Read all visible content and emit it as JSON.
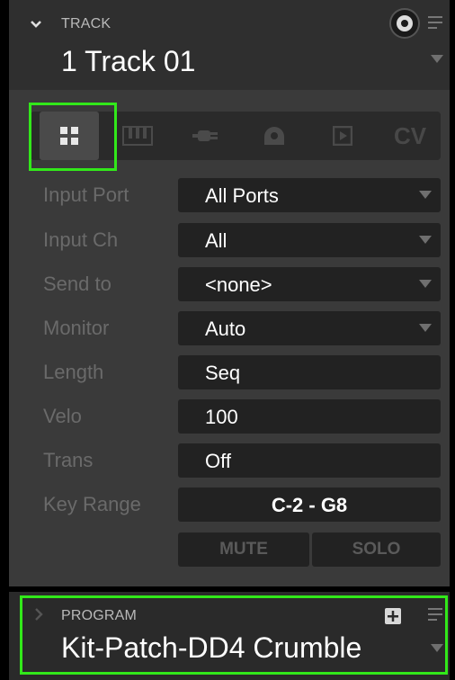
{
  "track": {
    "section_label": "TRACK",
    "name": "1 Track 01"
  },
  "tabs": [
    {
      "icon": "grid-icon",
      "active": true
    },
    {
      "icon": "piano-keys-icon",
      "active": false
    },
    {
      "icon": "plug-icon",
      "active": false
    },
    {
      "icon": "midi-port-icon",
      "active": false
    },
    {
      "icon": "play-box-icon",
      "active": false
    },
    {
      "label": "CV",
      "active": false
    }
  ],
  "rows": [
    {
      "label": "Input Port",
      "value": "All Ports"
    },
    {
      "label": "Input Ch",
      "value": "All"
    },
    {
      "label": "Send to",
      "value": "<none>"
    },
    {
      "label": "Monitor",
      "value": "Auto"
    },
    {
      "label": "Length",
      "value": "Seq"
    },
    {
      "label": "Velo",
      "value": "100"
    },
    {
      "label": "Trans",
      "value": "Off"
    },
    {
      "label": "Key Range",
      "value": "C-2 - G8"
    }
  ],
  "buttons": {
    "mute": "MUTE",
    "solo": "SOLO"
  },
  "program": {
    "section_label": "PROGRAM",
    "name": "Kit-Patch-DD4 Crumble"
  },
  "colors": {
    "highlight": "#32e81a",
    "panel": "#3a3a3a",
    "field": "#222222"
  }
}
